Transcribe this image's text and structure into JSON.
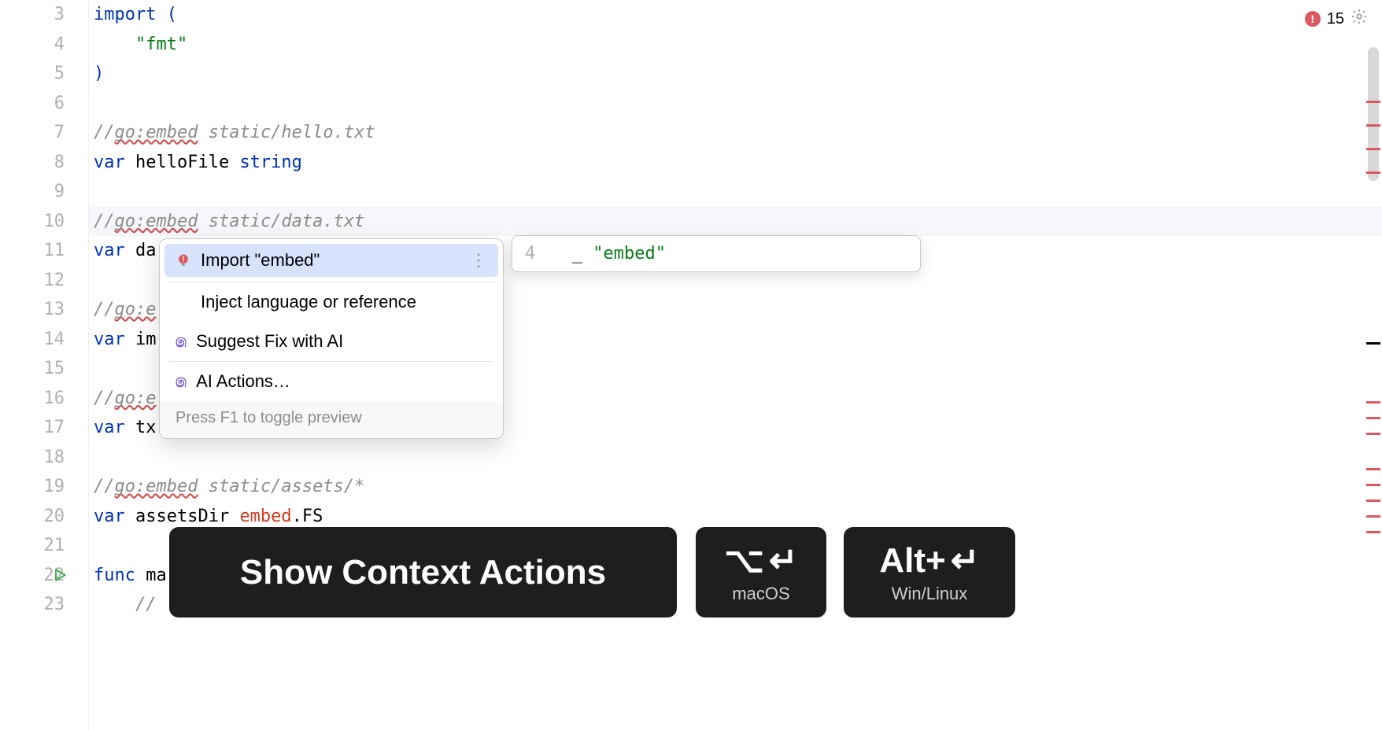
{
  "gutter": {
    "start": 3,
    "end": 23
  },
  "status": {
    "error_count": "15"
  },
  "code": {
    "l3": "import (",
    "l4_indent": "    ",
    "l4_str": "\"fmt\"",
    "l5": ")",
    "l6": "",
    "l7_cmt_prefix": "//",
    "l7_cmt_embed": "go:embed",
    "l7_cmt_path": " static/hello.txt",
    "l8_var": "var ",
    "l8_ident": "helloFile ",
    "l8_type": "string",
    "l10_cmt_prefix": "//",
    "l10_cmt_embed": "go:embed",
    "l10_cmt_path": " static/data.txt",
    "l11_var": "var ",
    "l11_ident": "da",
    "l13_cmt_prefix": "//",
    "l13_cmt_embed": "go:e",
    "l14_var": "var ",
    "l14_ident": "im",
    "l16_cmt_prefix": "//",
    "l16_cmt_embed": "go:e",
    "l17_var": "var ",
    "l17_ident": "tx",
    "l19_cmt_prefix": "//",
    "l19_cmt_embed": "go:embed",
    "l19_cmt_path": " static/assets/*",
    "l20_var": "var ",
    "l20_ident": "assetsDir ",
    "l20_err": "embed",
    "l20_rest": ".FS",
    "l22_func": "func ",
    "l22_ident": "ma",
    "l23_indent": "    ",
    "l23_cmt": "// "
  },
  "intention": {
    "items": [
      {
        "label": "Import \"embed\"",
        "icon": "bulb-error",
        "selected": true,
        "more": true
      },
      {
        "label": "Inject language or reference",
        "icon": "none"
      },
      {
        "label": "Suggest Fix with AI",
        "icon": "ai"
      },
      {
        "label": "AI Actions…",
        "icon": "ai"
      }
    ],
    "hint": "Press F1 to toggle preview"
  },
  "preview": {
    "line_no": "4",
    "content_prefix": "  _ ",
    "content_str": "\"embed\""
  },
  "tooltips": {
    "main": {
      "title": "Show Context Actions"
    },
    "mac": {
      "sub": "macOS"
    },
    "win": {
      "kbd_text": "Alt+",
      "sub": "Win/Linux"
    }
  }
}
